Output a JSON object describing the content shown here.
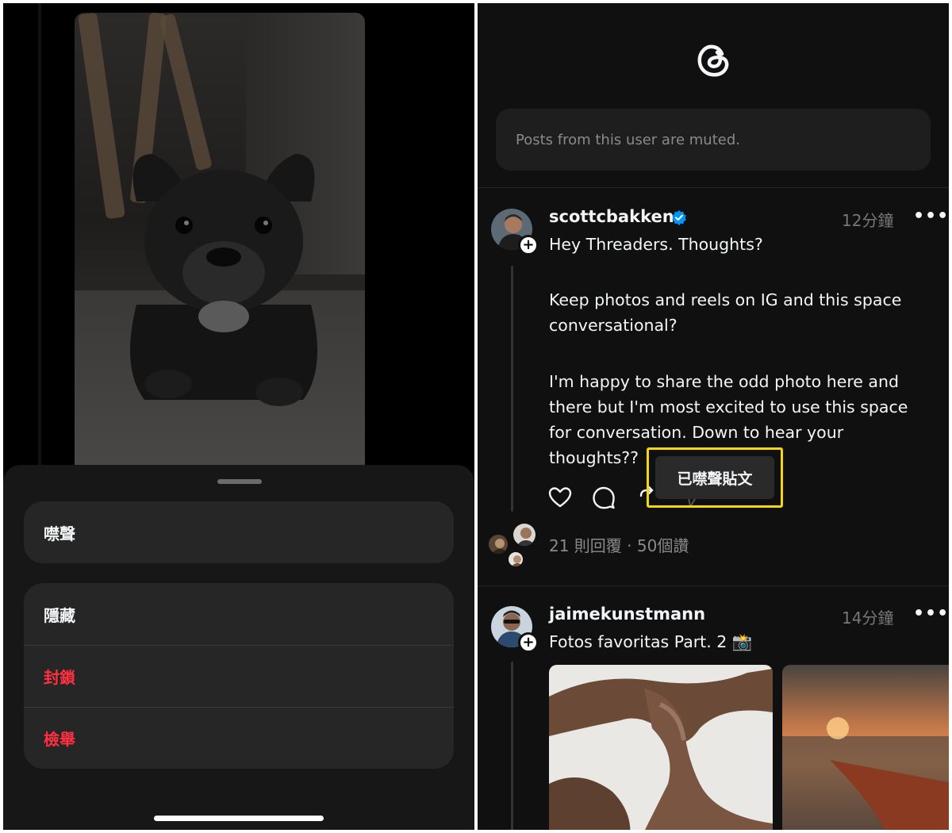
{
  "left_screen": {
    "action_sheet": {
      "group1": [
        {
          "label": "噤聲",
          "danger": false
        }
      ],
      "group2": [
        {
          "label": "隱藏",
          "danger": false
        },
        {
          "label": "封鎖",
          "danger": true
        },
        {
          "label": "檢舉",
          "danger": true
        }
      ]
    }
  },
  "right_screen": {
    "logo": "threads-logo-icon",
    "muted_notice": "Posts from this user are muted.",
    "post1": {
      "username": "scottcbakken",
      "verified": true,
      "time": "12分鐘",
      "text_lines": [
        "Hey Threaders. Thoughts?",
        "",
        "Keep photos and reels on IG and this space",
        "conversational?",
        "",
        "I'm happy to share the odd photo here and",
        "there but I'm most excited to use this space",
        "for conversation. Down to hear your",
        "thoughts??"
      ],
      "stats": "21 則回覆 · 50個讚",
      "toast": "已噤聲貼文"
    },
    "post2": {
      "username": "jaimekunstmann",
      "time": "14分鐘",
      "text": "Fotos favoritas Part. 2 📸"
    }
  },
  "colors": {
    "background": "#101010",
    "danger": "#ff3040",
    "verified": "#0095f6",
    "highlight": "#f6d70b"
  }
}
